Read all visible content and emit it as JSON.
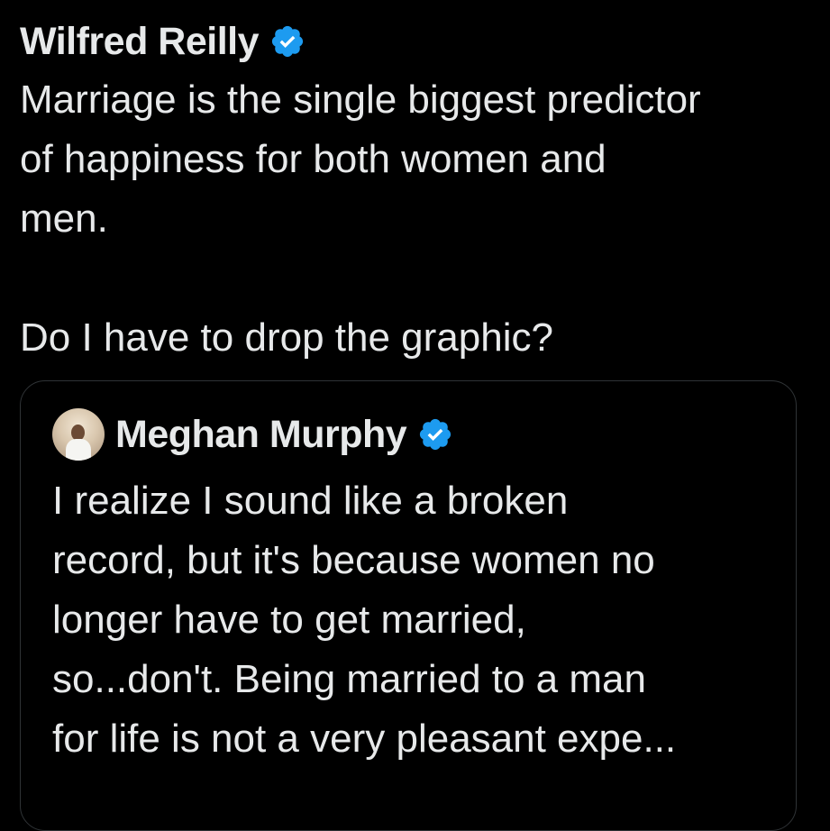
{
  "tweet": {
    "author": "Wilfred Reilly",
    "text_lines": [
      "Marriage is the single biggest predictor",
      "of happiness for both women and",
      "men.",
      "",
      "Do I have to drop the graphic?"
    ]
  },
  "quote": {
    "author": "Meghan Murphy",
    "text_lines": [
      "I realize I sound like a broken",
      "record, but it's because women no",
      "longer have to get married,",
      "so...don't. Being married to a man",
      "for life is not a very pleasant expe..."
    ]
  },
  "colors": {
    "background": "#000000",
    "text": "#e7e9ea",
    "verified_badge": "#1d9bf0",
    "border": "#2f3336"
  },
  "icons": {
    "verified": "verified-badge-icon",
    "avatar": "user-avatar"
  }
}
